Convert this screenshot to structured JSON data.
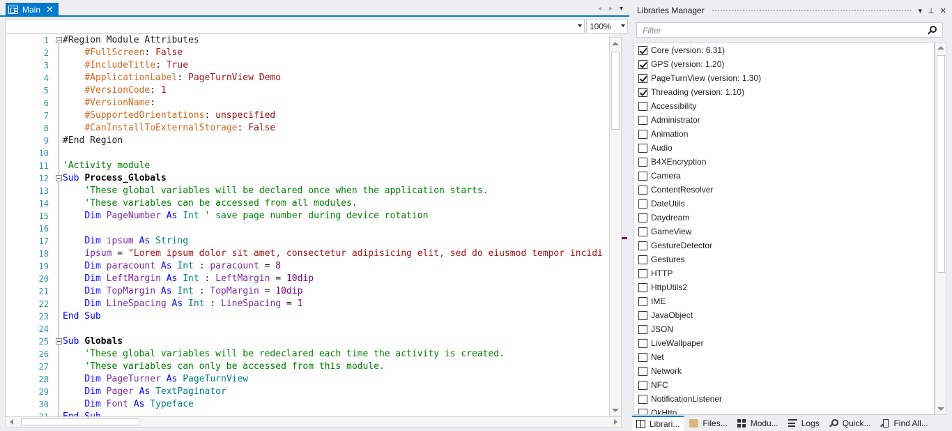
{
  "editor": {
    "tab": {
      "label": "Main",
      "close_glyph": "✕",
      "icon": "module-icon"
    },
    "tabstrip_controls": {
      "prev": "◂",
      "next": "▸",
      "menu": "▾"
    },
    "zoom": "100%",
    "lines": [
      {
        "n": "1",
        "fold": true,
        "parts": [
          [
            "p",
            "#Region Module Attributes"
          ]
        ]
      },
      {
        "n": "2",
        "parts": [
          [
            "p",
            "    "
          ],
          [
            "d",
            "#FullScreen"
          ],
          [
            "p",
            ": "
          ],
          [
            "s",
            "False"
          ]
        ]
      },
      {
        "n": "3",
        "parts": [
          [
            "p",
            "    "
          ],
          [
            "d",
            "#IncludeTitle"
          ],
          [
            "p",
            ": "
          ],
          [
            "s",
            "True"
          ]
        ]
      },
      {
        "n": "4",
        "parts": [
          [
            "p",
            "    "
          ],
          [
            "d",
            "#ApplicationLabel"
          ],
          [
            "p",
            ": "
          ],
          [
            "s",
            "PageTurnView Demo"
          ]
        ]
      },
      {
        "n": "5",
        "parts": [
          [
            "p",
            "    "
          ],
          [
            "d",
            "#VersionCode"
          ],
          [
            "p",
            ": "
          ],
          [
            "s",
            "1"
          ]
        ]
      },
      {
        "n": "6",
        "parts": [
          [
            "p",
            "    "
          ],
          [
            "d",
            "#VersionName"
          ],
          [
            "p",
            ":"
          ]
        ]
      },
      {
        "n": "7",
        "parts": [
          [
            "p",
            "    "
          ],
          [
            "d",
            "#SupportedOrientations"
          ],
          [
            "p",
            ": "
          ],
          [
            "s",
            "unspecified"
          ]
        ]
      },
      {
        "n": "8",
        "parts": [
          [
            "p",
            "    "
          ],
          [
            "d",
            "#CanInstallToExternalStorage"
          ],
          [
            "p",
            ": "
          ],
          [
            "s",
            "False"
          ]
        ]
      },
      {
        "n": "9",
        "parts": [
          [
            "p",
            "#End Region"
          ]
        ]
      },
      {
        "n": "10",
        "parts": []
      },
      {
        "n": "11",
        "parts": [
          [
            "c",
            "'Activity module"
          ]
        ]
      },
      {
        "n": "12",
        "fold": true,
        "parts": [
          [
            "k",
            "Sub "
          ],
          [
            "b",
            "Process_Globals"
          ]
        ]
      },
      {
        "n": "13",
        "parts": [
          [
            "p",
            "    "
          ],
          [
            "c",
            "'These global variables will be declared once when the application starts."
          ]
        ]
      },
      {
        "n": "14",
        "parts": [
          [
            "p",
            "    "
          ],
          [
            "c",
            "'These variables can be accessed from all modules."
          ]
        ]
      },
      {
        "n": "15",
        "parts": [
          [
            "p",
            "    "
          ],
          [
            "k",
            "Dim "
          ],
          [
            "v",
            "PageNumber"
          ],
          [
            "k",
            " As "
          ],
          [
            "t",
            "Int"
          ],
          [
            "c",
            " ' save page number during device rotation"
          ]
        ]
      },
      {
        "n": "16",
        "parts": []
      },
      {
        "n": "17",
        "parts": [
          [
            "p",
            "    "
          ],
          [
            "k",
            "Dim "
          ],
          [
            "v",
            "ipsum"
          ],
          [
            "k",
            " As "
          ],
          [
            "t",
            "String"
          ]
        ]
      },
      {
        "n": "18",
        "parts": [
          [
            "p",
            "    "
          ],
          [
            "v",
            "ipsum"
          ],
          [
            "p",
            " = "
          ],
          [
            "s",
            "\"Lorem ipsum dolor sit amet, consectetur adipisicing elit, sed do eiusmod tempor incidi"
          ]
        ]
      },
      {
        "n": "19",
        "parts": [
          [
            "p",
            "    "
          ],
          [
            "k",
            "Dim "
          ],
          [
            "v",
            "paracount"
          ],
          [
            "k",
            " As "
          ],
          [
            "t",
            "Int"
          ],
          [
            "p",
            " : "
          ],
          [
            "v",
            "paracount"
          ],
          [
            "p",
            " = "
          ],
          [
            "n",
            "8"
          ]
        ]
      },
      {
        "n": "20",
        "parts": [
          [
            "p",
            "    "
          ],
          [
            "k",
            "Dim "
          ],
          [
            "v",
            "LeftMargin"
          ],
          [
            "k",
            " As "
          ],
          [
            "t",
            "Int"
          ],
          [
            "p",
            " : "
          ],
          [
            "v",
            "LeftMargin"
          ],
          [
            "p",
            " = "
          ],
          [
            "n",
            "10dip"
          ]
        ]
      },
      {
        "n": "21",
        "parts": [
          [
            "p",
            "    "
          ],
          [
            "k",
            "Dim "
          ],
          [
            "v",
            "TopMargin"
          ],
          [
            "k",
            " As "
          ],
          [
            "t",
            "Int"
          ],
          [
            "p",
            " : "
          ],
          [
            "v",
            "TopMargin"
          ],
          [
            "p",
            " = "
          ],
          [
            "n",
            "10dip"
          ]
        ]
      },
      {
        "n": "22",
        "parts": [
          [
            "p",
            "    "
          ],
          [
            "k",
            "Dim "
          ],
          [
            "v",
            "LineSpacing"
          ],
          [
            "k",
            " As "
          ],
          [
            "t",
            "Int"
          ],
          [
            "p",
            " : "
          ],
          [
            "v",
            "LineSpacing"
          ],
          [
            "p",
            " = "
          ],
          [
            "n",
            "1"
          ]
        ]
      },
      {
        "n": "23",
        "parts": [
          [
            "k",
            "End Sub"
          ]
        ]
      },
      {
        "n": "24",
        "parts": []
      },
      {
        "n": "25",
        "fold": true,
        "parts": [
          [
            "k",
            "Sub "
          ],
          [
            "b",
            "Globals"
          ]
        ]
      },
      {
        "n": "26",
        "parts": [
          [
            "p",
            "    "
          ],
          [
            "c",
            "'These global variables will be redeclared each time the activity is created."
          ]
        ]
      },
      {
        "n": "27",
        "parts": [
          [
            "p",
            "    "
          ],
          [
            "c",
            "'These variables can only be accessed from this module."
          ]
        ]
      },
      {
        "n": "28",
        "parts": [
          [
            "p",
            "    "
          ],
          [
            "k",
            "Dim "
          ],
          [
            "v",
            "PageTurner"
          ],
          [
            "k",
            " As "
          ],
          [
            "t",
            "PageTurnView"
          ]
        ]
      },
      {
        "n": "29",
        "parts": [
          [
            "p",
            "    "
          ],
          [
            "k",
            "Dim "
          ],
          [
            "v",
            "Pager"
          ],
          [
            "k",
            " As "
          ],
          [
            "t",
            "TextPaginator"
          ]
        ]
      },
      {
        "n": "30",
        "parts": [
          [
            "p",
            "    "
          ],
          [
            "k",
            "Dim "
          ],
          [
            "v",
            "Font"
          ],
          [
            "k",
            " As "
          ],
          [
            "t",
            "Typeface"
          ]
        ]
      },
      {
        "n": "31",
        "parts": [
          [
            "k",
            "End Sub"
          ]
        ]
      }
    ]
  },
  "libraries": {
    "title": "Libraries Manager",
    "header_buttons": {
      "menu": "▾",
      "pin": "⊥",
      "close": "✕"
    },
    "filter_placeholder": "Filter",
    "items": [
      {
        "label": "Core (version: 6.31)",
        "checked": true
      },
      {
        "label": "GPS (version: 1.20)",
        "checked": true
      },
      {
        "label": "PageTurnView (version: 1.30)",
        "checked": true
      },
      {
        "label": "Threading (version: 1.10)",
        "checked": true
      },
      {
        "label": "Accessibility",
        "checked": false
      },
      {
        "label": "Administrator",
        "checked": false
      },
      {
        "label": "Animation",
        "checked": false
      },
      {
        "label": "Audio",
        "checked": false
      },
      {
        "label": "B4XEncryption",
        "checked": false
      },
      {
        "label": "Camera",
        "checked": false
      },
      {
        "label": "ContentResolver",
        "checked": false
      },
      {
        "label": "DateUtils",
        "checked": false
      },
      {
        "label": "Daydream",
        "checked": false
      },
      {
        "label": "GameView",
        "checked": false
      },
      {
        "label": "GestureDetector",
        "checked": false
      },
      {
        "label": "Gestures",
        "checked": false
      },
      {
        "label": "HTTP",
        "checked": false
      },
      {
        "label": "HttpUtils2",
        "checked": false
      },
      {
        "label": "IME",
        "checked": false
      },
      {
        "label": "JavaObject",
        "checked": false
      },
      {
        "label": "JSON",
        "checked": false
      },
      {
        "label": "LiveWallpaper",
        "checked": false
      },
      {
        "label": "Net",
        "checked": false
      },
      {
        "label": "Network",
        "checked": false
      },
      {
        "label": "NFC",
        "checked": false
      },
      {
        "label": "NotificationListener",
        "checked": false
      },
      {
        "label": "OkHttp",
        "checked": false
      }
    ]
  },
  "bottom_tabs": [
    {
      "label": "Librari...",
      "icon": "book-icon",
      "glyph": "gl-book",
      "active": true
    },
    {
      "label": "Files...",
      "icon": "folder-icon",
      "glyph": "gl-folder",
      "active": false
    },
    {
      "label": "Modu...",
      "icon": "modules-icon",
      "glyph": "gl-modules",
      "active": false
    },
    {
      "label": "Logs",
      "icon": "logs-icon",
      "glyph": "gl-logs",
      "active": false
    },
    {
      "label": "Quick...",
      "icon": "quick-search-icon",
      "glyph": "gl-quick",
      "active": false
    },
    {
      "label": "Find All...",
      "icon": "find-all-icon",
      "glyph": "gl-find",
      "active": false
    }
  ]
}
